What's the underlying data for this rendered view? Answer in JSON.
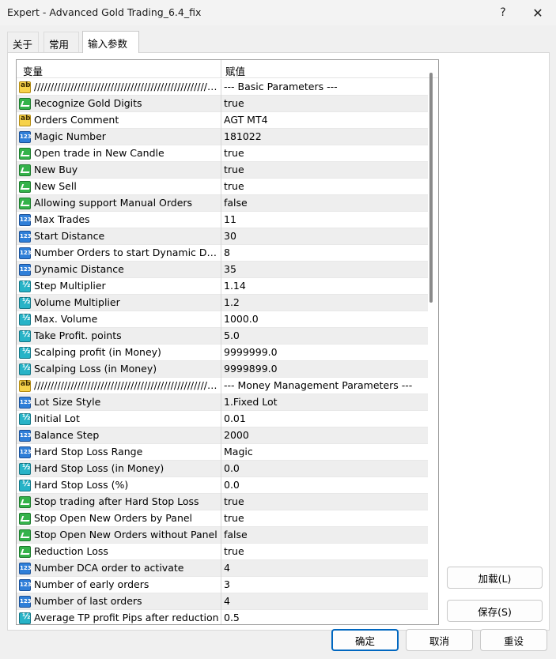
{
  "window": {
    "title": "Expert - Advanced Gold Trading_6.4_fix",
    "help_label": "?",
    "close_label": "✕"
  },
  "tabs": [
    {
      "label": "关于",
      "active": false
    },
    {
      "label": "常用",
      "active": false
    },
    {
      "label": "输入参数",
      "active": true
    }
  ],
  "grid": {
    "col_variable": "变量",
    "col_value": "赋值",
    "rows": [
      {
        "type": "ab",
        "name": "/////////////////////////////////////////////////////////",
        "value": "--- Basic Parameters ---"
      },
      {
        "type": "bool",
        "name": "Recognize Gold Digits",
        "value": "true"
      },
      {
        "type": "ab",
        "name": "Orders Comment",
        "value": "AGT MT4"
      },
      {
        "type": "int",
        "name": "Magic Number",
        "value": "181022"
      },
      {
        "type": "bool",
        "name": "Open trade in New Candle",
        "value": "true"
      },
      {
        "type": "bool",
        "name": "New Buy",
        "value": "true"
      },
      {
        "type": "bool",
        "name": "New Sell",
        "value": "true"
      },
      {
        "type": "bool",
        "name": "Allowing support Manual Orders",
        "value": "false"
      },
      {
        "type": "int",
        "name": "Max Trades",
        "value": "11"
      },
      {
        "type": "int",
        "name": "Start Distance",
        "value": "30"
      },
      {
        "type": "int",
        "name": "Number Orders to start Dynamic Dist...",
        "value": "8"
      },
      {
        "type": "int",
        "name": "Dynamic Distance",
        "value": "35"
      },
      {
        "type": "dbl",
        "name": "Step Multiplier",
        "value": "1.14"
      },
      {
        "type": "dbl",
        "name": "Volume Multiplier",
        "value": "1.2"
      },
      {
        "type": "dbl",
        "name": "Max. Volume",
        "value": "1000.0"
      },
      {
        "type": "dbl",
        "name": "Take Profit. points",
        "value": "5.0"
      },
      {
        "type": "dbl",
        "name": "Scalping profit (in Money)",
        "value": "9999999.0"
      },
      {
        "type": "dbl",
        "name": "Scalping Loss (in Money)",
        "value": "9999899.0"
      },
      {
        "type": "ab",
        "name": "/////////////////////////////////////////////////////////...",
        "value": "--- Money Management Parameters ---"
      },
      {
        "type": "int",
        "name": "Lot Size Style",
        "value": "1.Fixed Lot"
      },
      {
        "type": "dbl",
        "name": "Initial Lot",
        "value": "0.01"
      },
      {
        "type": "int",
        "name": "Balance Step",
        "value": "2000"
      },
      {
        "type": "int",
        "name": "Hard Stop Loss Range",
        "value": "Magic"
      },
      {
        "type": "dbl",
        "name": "Hard Stop Loss (in Money)",
        "value": "0.0"
      },
      {
        "type": "dbl",
        "name": "Hard Stop Loss (%)",
        "value": "0.0"
      },
      {
        "type": "bool",
        "name": "Stop trading after Hard Stop Loss",
        "value": "true"
      },
      {
        "type": "bool",
        "name": "Stop Open New Orders by Panel",
        "value": "true"
      },
      {
        "type": "bool",
        "name": "Stop Open New Orders without Panel",
        "value": "false"
      },
      {
        "type": "bool",
        "name": "Reduction Loss",
        "value": "true"
      },
      {
        "type": "int",
        "name": "Number DCA order to activate",
        "value": "4"
      },
      {
        "type": "int",
        "name": "Number of early orders",
        "value": "3"
      },
      {
        "type": "int",
        "name": "Number of last orders",
        "value": "4"
      },
      {
        "type": "dbl",
        "name": "Average TP profit Pips after reduction",
        "value": "0.5"
      }
    ]
  },
  "buttons": {
    "load": "加载(L)",
    "save": "保存(S)",
    "ok": "确定",
    "cancel": "取消",
    "reset": "重设"
  }
}
